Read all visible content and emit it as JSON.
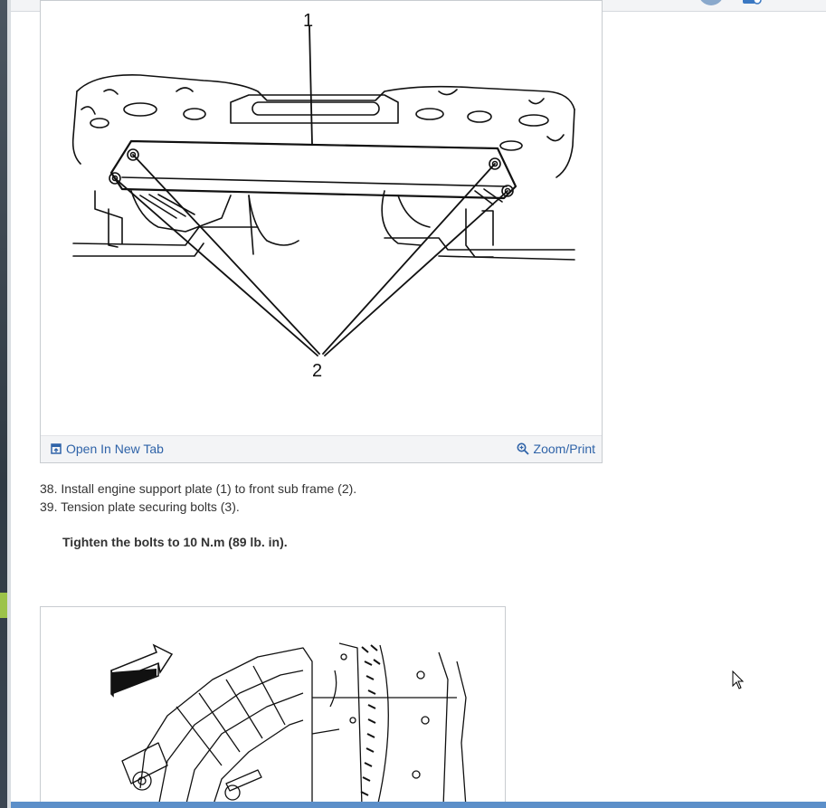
{
  "figure1": {
    "callouts": [
      "1",
      "2"
    ],
    "open_tab_label": "Open In New Tab",
    "zoom_label": "Zoom/Print",
    "icons": {
      "open_tab": "open-new-tab-icon",
      "zoom": "magnifier-zoom-icon"
    }
  },
  "steps": [
    {
      "text": "38. Install engine support plate (1) to front sub frame (2)."
    },
    {
      "text": "39. Tension plate securing bolts (3)."
    }
  ],
  "note": "Tighten the bolts to 10 N.m (89 lb. in).",
  "colors": {
    "link": "#2f63a8",
    "text": "#333333",
    "footer_bg": "#f3f4f6",
    "bottom_edge": "#5c8fc9"
  }
}
